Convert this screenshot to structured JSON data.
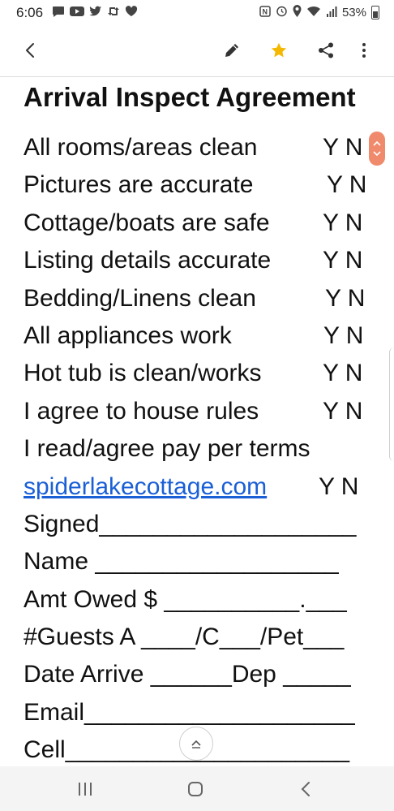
{
  "status_bar": {
    "time": "6:06",
    "battery": "53%",
    "left_icons": [
      "message-icon",
      "youtube-icon",
      "twitter-icon",
      "retweet-icon",
      "heart-icon"
    ],
    "right_icons": [
      "nfc-icon",
      "alarm-icon",
      "location-icon",
      "wifi-icon",
      "signal-icon",
      "battery-icon"
    ]
  },
  "toolbar": {
    "icons": [
      "back-arrow-icon",
      "pencil-icon",
      "star-icon",
      "share-icon",
      "more-vertical-icon"
    ],
    "accent": "#f5b800"
  },
  "document": {
    "title": "Arrival Inspect Agreement",
    "items": [
      {
        "label": "All rooms/areas clean",
        "answer": "Y N"
      },
      {
        "label": "Pictures are accurate",
        "answer": "Y N"
      },
      {
        "label": "Cottage/boats are safe",
        "answer": "Y N"
      },
      {
        "label": "Listing details accurate",
        "answer": "Y N"
      },
      {
        "label": "Bedding/Linens clean",
        "answer": "Y N"
      },
      {
        "label": "All appliances work",
        "answer": "Y N"
      },
      {
        "label": "Hot tub is clean/works",
        "answer": "Y N"
      },
      {
        "label": "I agree to house rules",
        "answer": "Y N"
      }
    ],
    "terms_line": "I read/agree pay per terms",
    "link_text": "spiderlakecottage.com",
    "link_answer": "Y N",
    "link_color": "#1a5fd6",
    "fields": [
      "Signed___________________",
      "Name __________________",
      "Amt Owed $ __________.___",
      "#Guests A ____/C___/Pet___",
      "Date Arrive ______Dep _____",
      "Email____________________",
      "Cell_____________________"
    ]
  },
  "scroll_handle_color": "#f08a6c",
  "nav_bar": {
    "icons": [
      "recent-apps-icon",
      "home-icon",
      "back-nav-icon"
    ]
  }
}
